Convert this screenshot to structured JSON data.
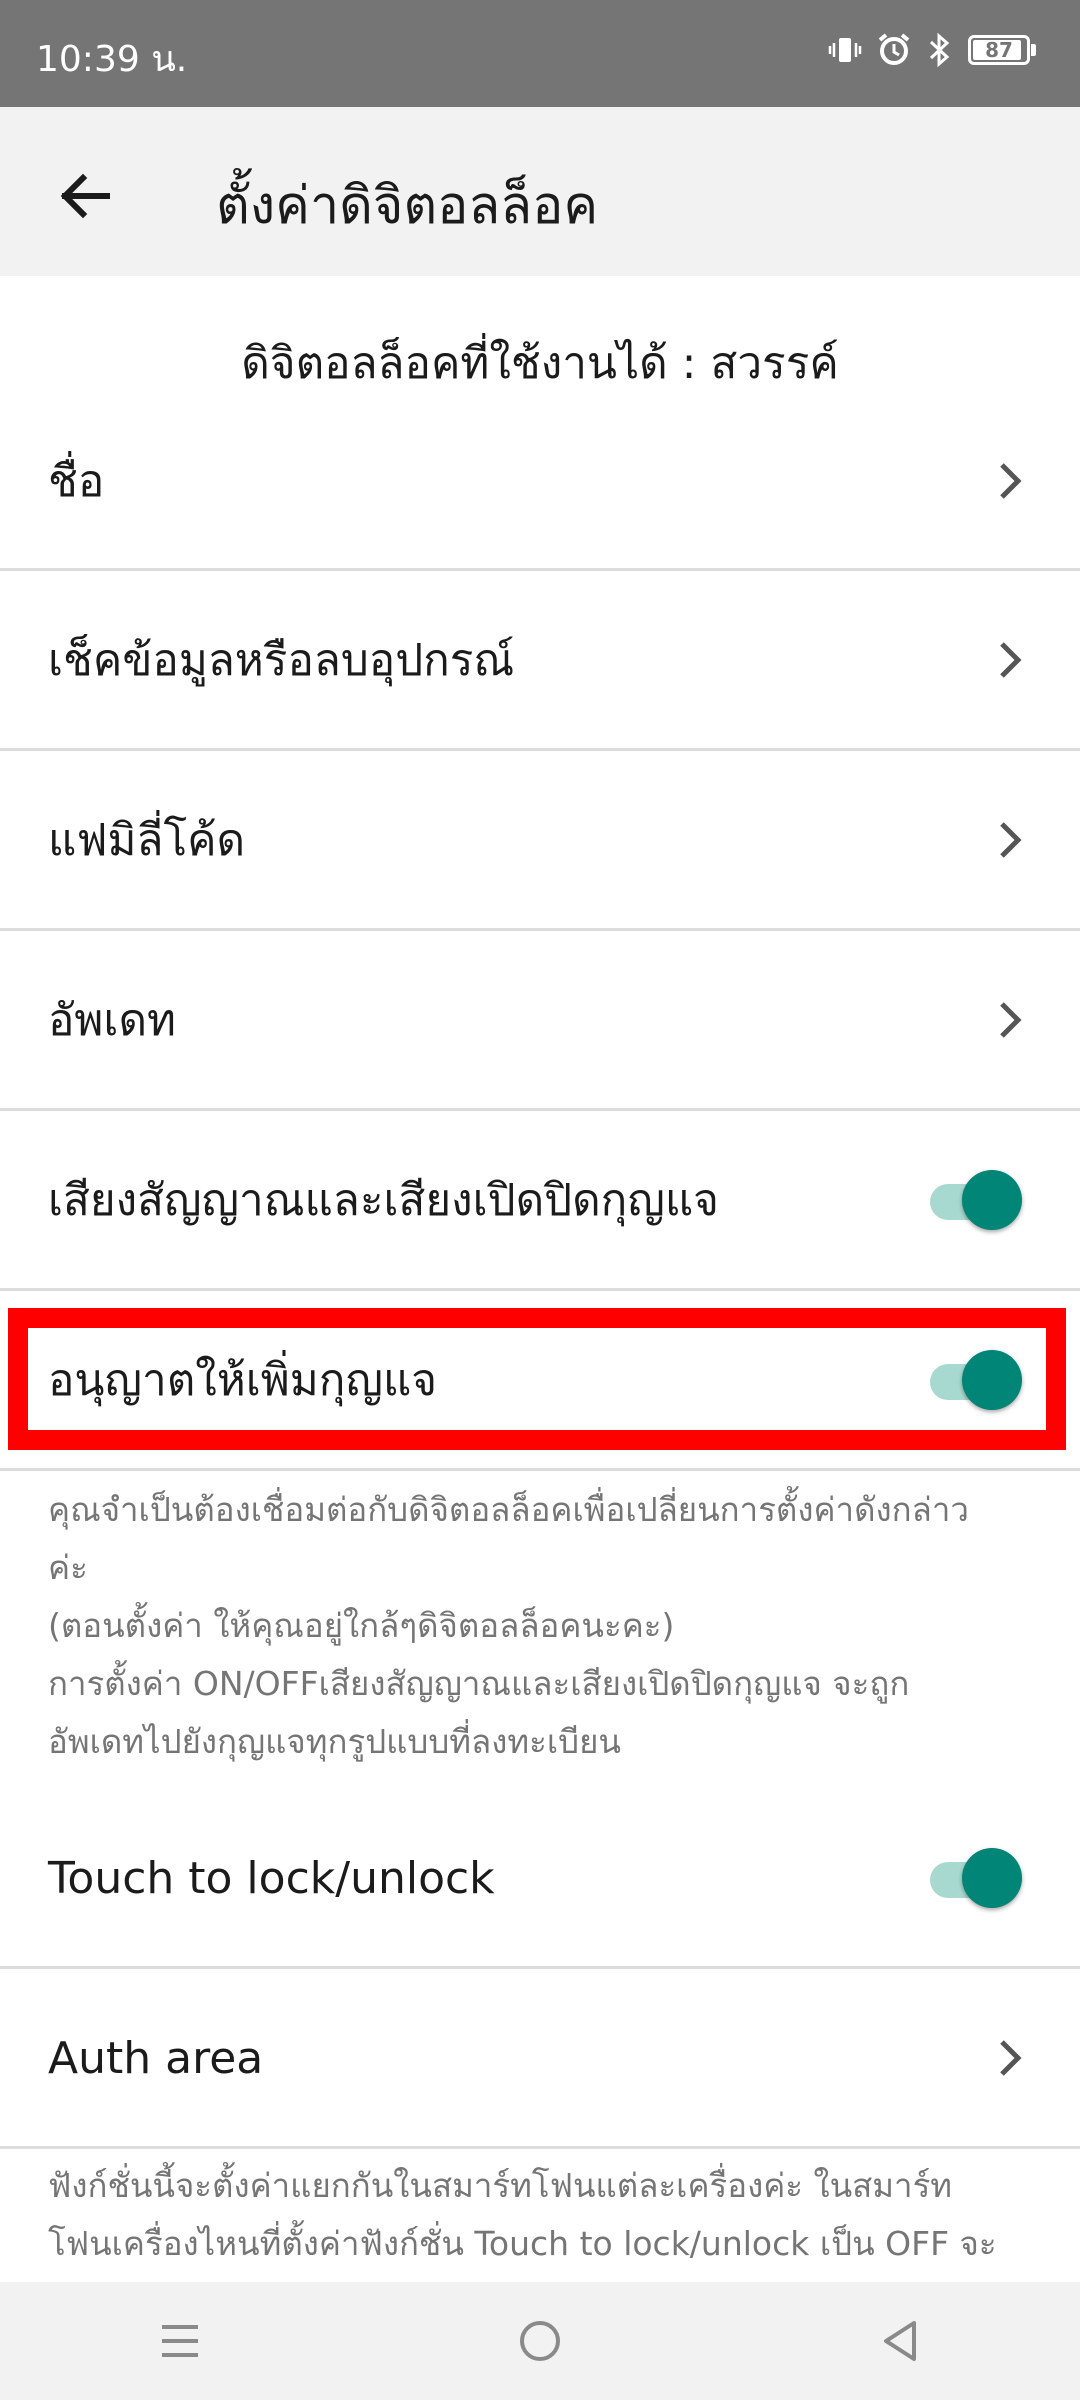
{
  "status_bar": {
    "time": "10:39 น.",
    "battery": "87",
    "icons": [
      "vibrate-icon",
      "alarm-icon",
      "bluetooth-icon",
      "battery-icon"
    ]
  },
  "app_bar": {
    "title": "ตั้งค่าดิจิตอลล็อค",
    "back_icon": "arrow-left-icon"
  },
  "section_caption": "ดิจิตอลล็อคที่ใช้งานได้ : สวรรค์",
  "rows": [
    {
      "label": "ชื่อ",
      "control": "chevron"
    },
    {
      "label": "เช็คข้อมูลหรือลบอุปกรณ์",
      "control": "chevron"
    },
    {
      "label": "แฟมิลี่โค้ด",
      "control": "chevron"
    },
    {
      "label": "อัพเดท",
      "control": "chevron"
    },
    {
      "label": "เสียงสัญญาณและเสียงเปิดปิดกุญแจ",
      "control": "toggle",
      "on": true
    },
    {
      "label": "อนุญาตให้เพิ่มกุญแจ",
      "control": "toggle",
      "on": true
    }
  ],
  "note1": [
    "คุณจำเป็นต้องเชื่อมต่อกับดิจิตอลล็อคเพื่อเปลี่ยนการตั้งค่าดังกล่าว",
    "ค่ะ",
    "(ตอนตั้งค่า ให้คุณอยู่ใกล้ๆดิจิตอลล็อคนะคะ)",
    "การตั้งค่า ON/OFFเสียงสัญญาณและเสียงเปิดปิดกุญแจ จะถูก",
    "อัพเดทไปยังกุญแจทุกรูปแบบที่ลงทะเบียน"
  ],
  "rows2": [
    {
      "label": "Touch to lock/unlock",
      "control": "toggle",
      "on": true
    },
    {
      "label": "Auth area",
      "control": "chevron"
    }
  ],
  "note2": [
    "ฟังก์ชั่นนี้จะตั้งค่าแยกกันในสมาร์ทโฟนแต่ละเครื่องค่ะ ในสมาร์ท",
    "โฟนเครื่องไหนที่ตั้งค่าฟังก์ชั่น Touch to lock/unlock เป็น OFF จะ"
  ],
  "nav_bar": {
    "icons": [
      "menu-icon",
      "home-icon",
      "back-triangle-icon"
    ]
  },
  "colors": {
    "status_bar": "#757575",
    "app_bar": "#f2f2f2",
    "toggle_on": "#008577",
    "toggle_track": "#a8d9d0",
    "highlight": "#ff0000"
  }
}
